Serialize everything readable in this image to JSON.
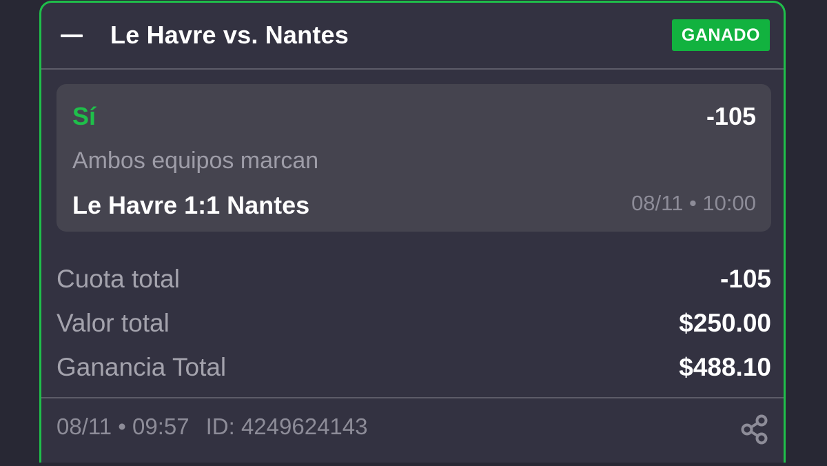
{
  "header": {
    "match_title": "Le Havre vs. Nantes",
    "status": "GANADO"
  },
  "selection": {
    "pick": "Sí",
    "odds": "-105",
    "market": "Ambos equipos marcan",
    "event_result": "Le Havre 1:1 Nantes",
    "event_datetime": "08/11 • 10:00"
  },
  "summary": [
    {
      "label": "Cuota total",
      "value": "-105"
    },
    {
      "label": "Valor total",
      "value": "$250.00"
    },
    {
      "label": "Ganancia Total",
      "value": "$488.10"
    }
  ],
  "footer": {
    "placed_at": "08/11 • 09:57",
    "bet_id": "ID: 4249624143"
  },
  "colors": {
    "background": "#282834",
    "card": "#333241",
    "selection_box": "#45444f",
    "accent_green": "#1fbf4a",
    "badge_green": "#12b23f",
    "muted_text": "#9e9da8"
  },
  "icons": {
    "collapse": "minus-icon",
    "share": "share-icon"
  }
}
